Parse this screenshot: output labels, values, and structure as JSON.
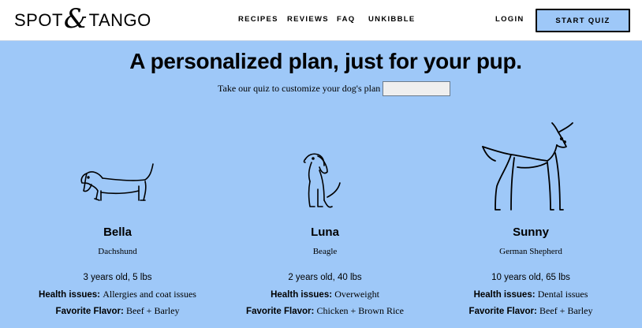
{
  "header": {
    "logo_left": "SPOT",
    "logo_amp": "&",
    "logo_right": "TANGO",
    "nav": [
      "RECIPES",
      "REVIEWS",
      "FAQ",
      "UNKIBBLE"
    ],
    "login": "LOGIN",
    "start_quiz": "START QUIZ"
  },
  "main": {
    "headline": "A personalized plan, just for your pup.",
    "subline": "Take our quiz to customize your dog's plan",
    "input_value": ""
  },
  "dogs": [
    {
      "name": "Bella",
      "breed": "Dachshund",
      "age": "3 years old, 5 lbs",
      "health_label": "Health issues:",
      "health_value": "Allergies and coat issues",
      "flavor_label": "Favorite Flavor:",
      "flavor_value": "Beef + Barley",
      "icon": "dachshund-icon"
    },
    {
      "name": "Luna",
      "breed": "Beagle",
      "age": "2 years old, 40 lbs",
      "health_label": "Health issues:",
      "health_value": "Overweight",
      "flavor_label": "Favorite Flavor:",
      "flavor_value": "Chicken + Brown Rice",
      "icon": "beagle-icon"
    },
    {
      "name": "Sunny",
      "breed": "German Shepherd",
      "age": "10 years old, 65 lbs",
      "health_label": "Health issues:",
      "health_value": "Dental issues",
      "flavor_label": "Favorite Flavor:",
      "flavor_value": "Beef + Barley",
      "icon": "german-shepherd-icon"
    }
  ],
  "colors": {
    "background": "#9ec8f8",
    "header": "#ffffff",
    "ink": "#000000"
  }
}
